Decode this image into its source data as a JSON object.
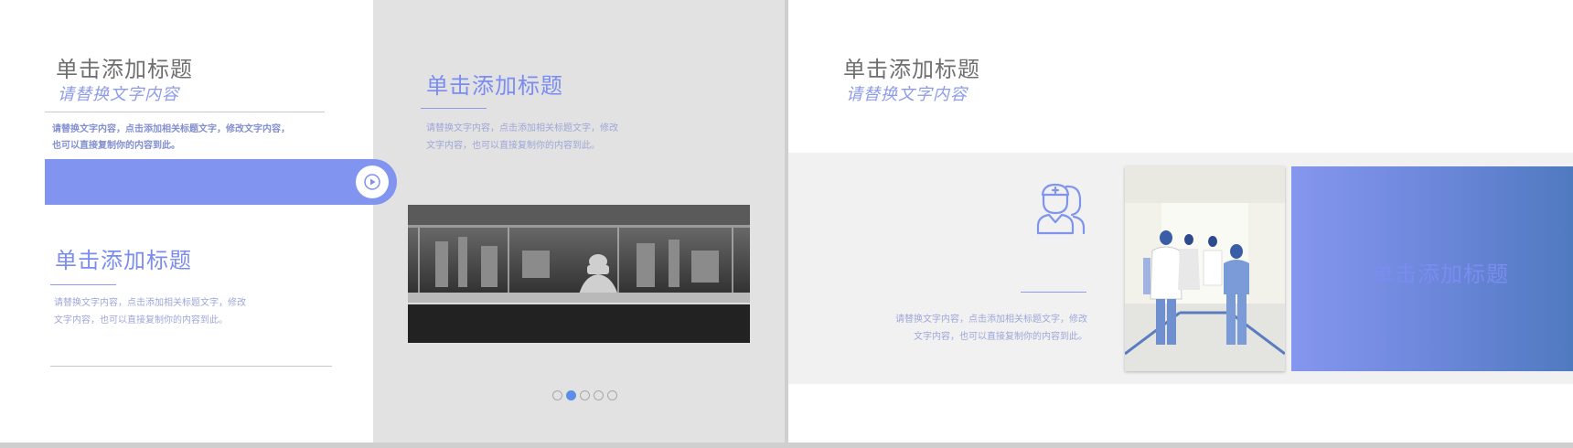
{
  "left_slide": {
    "top_block": {
      "title": "单击添加标题",
      "subtitle": "请替换文字内容",
      "body_line1": "请替换文字内容，点击添加相关标题文字，修改文字内容，",
      "body_line2": "也可以直接复制你的内容到此。"
    },
    "play_icon": "play-icon",
    "lower_block": {
      "title": "单击添加标题",
      "body_line1": "请替换文字内容，点击添加相关标题文字，修改",
      "body_line2": "文字内容，也可以直接复制你的内容到此。"
    },
    "right_block": {
      "title": "单击添加标题",
      "body_line1": "请替换文字内容，点击添加相关标题文字，修改",
      "body_line2": "文字内容，也可以直接复制你的内容到此。"
    },
    "carousel": {
      "total": 5,
      "active_index": 2
    }
  },
  "right_slide": {
    "header": {
      "title": "单击添加标题",
      "subtitle": "请替换文字内容"
    },
    "feature": {
      "icon": "doctor-icon",
      "title": "单击添加标题",
      "body_line1": "请替换文字内容，点击添加相关标题文字，修改",
      "body_line2": "文字内容，也可以直接复制你的内容到此。"
    }
  },
  "colors": {
    "accent": "#8194ef",
    "accent_light": "#7b8cf0",
    "gradient_start": "#8596ef",
    "gradient_end": "#4f7ac0",
    "dot_active": "#5b8ee8",
    "panel_gray": "#e2e2e2"
  }
}
